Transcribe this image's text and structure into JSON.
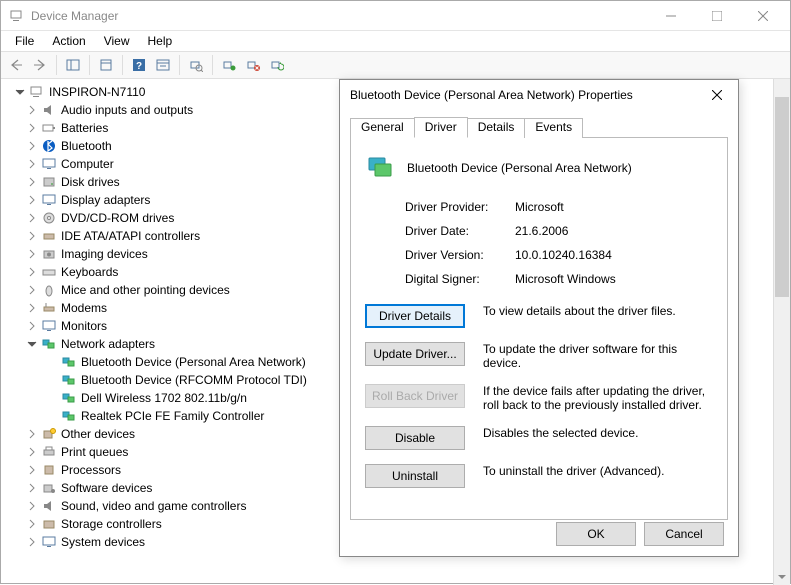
{
  "window": {
    "title": "Device Manager"
  },
  "menu": {
    "file": "File",
    "action": "Action",
    "view": "View",
    "help": "Help"
  },
  "tree": {
    "root": "INSPIRON-N7110",
    "items": [
      "Audio inputs and outputs",
      "Batteries",
      "Bluetooth",
      "Computer",
      "Disk drives",
      "Display adapters",
      "DVD/CD-ROM drives",
      "IDE ATA/ATAPI controllers",
      "Imaging devices",
      "Keyboards",
      "Mice and other pointing devices",
      "Modems",
      "Monitors",
      "Network adapters",
      "Other devices",
      "Print queues",
      "Processors",
      "Software devices",
      "Sound, video and game controllers",
      "Storage controllers",
      "System devices"
    ],
    "network_children": [
      "Bluetooth Device (Personal Area Network)",
      "Bluetooth Device (RFCOMM Protocol TDI)",
      "Dell Wireless 1702 802.11b/g/n",
      "Realtek PCIe FE Family Controller"
    ]
  },
  "dialog": {
    "title": "Bluetooth Device (Personal Area Network) Properties",
    "tabs": {
      "general": "General",
      "driver": "Driver",
      "details": "Details",
      "events": "Events"
    },
    "device_name": "Bluetooth Device (Personal Area Network)",
    "fields": {
      "provider_label": "Driver Provider:",
      "provider_value": "Microsoft",
      "date_label": "Driver Date:",
      "date_value": "21.6.2006",
      "version_label": "Driver Version:",
      "version_value": "10.0.10240.16384",
      "signer_label": "Digital Signer:",
      "signer_value": "Microsoft Windows"
    },
    "buttons": {
      "details": "Driver Details",
      "details_desc": "To view details about the driver files.",
      "update": "Update Driver...",
      "update_desc": "To update the driver software for this device.",
      "rollback": "Roll Back Driver",
      "rollback_desc": "If the device fails after updating the driver, roll back to the previously installed driver.",
      "disable": "Disable",
      "disable_desc": "Disables the selected device.",
      "uninstall": "Uninstall",
      "uninstall_desc": "To uninstall the driver (Advanced).",
      "ok": "OK",
      "cancel": "Cancel"
    }
  }
}
